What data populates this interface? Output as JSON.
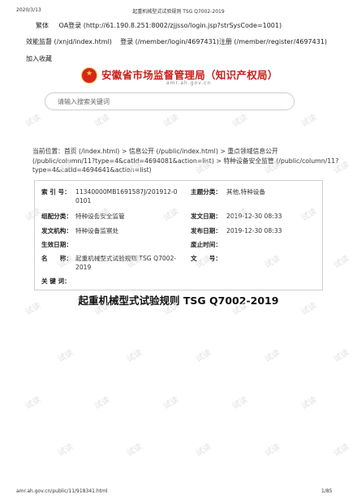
{
  "print_header": {
    "date": "2020/3/13",
    "title": "起重机械型式试验规则 TSG Q7002-2019"
  },
  "topbar": {
    "traditional": "繁体",
    "oa": "OA登录 (http://61.190.8.251:8002/zjjsso/login.jsp?strSysCode=1001)"
  },
  "links": {
    "supervision": "效能监督 (/xnjd/index.html)",
    "login_register": "登录 (/member/login/4697431)注册 (/member/register/4697431)",
    "favorite": "加入收藏"
  },
  "logo": {
    "name": "安徽省市场监督管理局（知识产权局）",
    "url": "amr.ah.gov.cn"
  },
  "search": {
    "placeholder": "请输入搜索关键词"
  },
  "breadcrumb": "当前位置：首页 (/index.html) > 信息公开 (/public/index.html) > 重点领域信息公开 (/public/column/11?type=4&catId=4694081&action=list) > 特种设备安全监管 (/public/column/11?type=4&catId=4694641&action=list)",
  "meta": {
    "index_label": "索 引 号：",
    "index_value": "11340000MB1691587J/201912-00101",
    "topic_label": "主题分类：",
    "topic_value": "其他,特种设备",
    "org_label": "组配分类：",
    "org_value": "特种设备安全监管",
    "pubdate_label": "发文日期：",
    "pubdate_value": "2019-12-30 08:33",
    "issuer_label": "发文机构：",
    "issuer_value": "特种设备监察处",
    "release_label": "发布日期：",
    "release_value": "2019-12-30 08:33",
    "effective_label": "生效日期：",
    "effective_value": "",
    "abolish_label": "废止时间：",
    "abolish_value": "",
    "name_label": "名　　称：",
    "name_value": "起重机械型式试验规则 TSG Q7002-2019",
    "docno_label": "文　　号：",
    "docno_value": "",
    "keywords_label": "关 键 词：",
    "keywords_value": ""
  },
  "document": {
    "title": "起重机械型式试验规则 TSG Q7002-2019"
  },
  "watermark": "试读",
  "print_footer": {
    "url": "amr.ah.gov.cn/public/11/918341.html",
    "page": "1/85"
  }
}
